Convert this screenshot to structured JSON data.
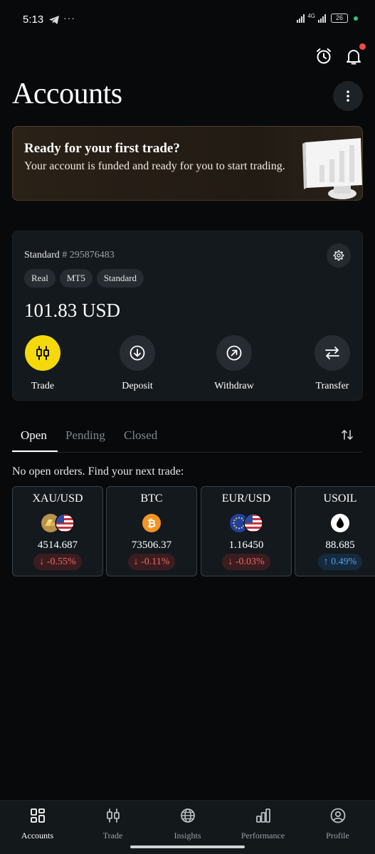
{
  "status": {
    "time": "5:13",
    "more": "···",
    "network": "4G",
    "battery": "26"
  },
  "header": {
    "title": "Accounts"
  },
  "banner": {
    "title": "Ready for your first trade?",
    "text": "Your account is funded and ready for you to start trading."
  },
  "account": {
    "type": "Standard",
    "hash": "#",
    "number": "295876483",
    "tags": [
      "Real",
      "MT5",
      "Standard"
    ],
    "balance": "101.83 USD",
    "actions": [
      {
        "label": "Trade",
        "icon": "candles-icon"
      },
      {
        "label": "Deposit",
        "icon": "arrow-down-circle-icon"
      },
      {
        "label": "Withdraw",
        "icon": "arrow-up-right-circle-icon"
      },
      {
        "label": "Transfer",
        "icon": "transfer-arrows-icon"
      }
    ]
  },
  "tabs": [
    "Open",
    "Pending",
    "Closed"
  ],
  "orders": {
    "empty_message": "No open orders. Find your next trade:"
  },
  "instruments": [
    {
      "name": "XAU/USD",
      "price": "4514.687",
      "change": "-0.55%",
      "direction": "down"
    },
    {
      "name": "BTC",
      "price": "73506.37",
      "change": "-0.11%",
      "direction": "down"
    },
    {
      "name": "EUR/USD",
      "price": "1.16450",
      "change": "-0.03%",
      "direction": "down"
    },
    {
      "name": "USOIL",
      "price": "88.685",
      "change": "0.49%",
      "direction": "up"
    }
  ],
  "nav": [
    "Accounts",
    "Trade",
    "Insights",
    "Performance",
    "Profile"
  ],
  "colors": {
    "accent": "#f5d90a",
    "negative": "#ee6a64",
    "positive": "#4fa4ee",
    "background": "#07090b"
  }
}
